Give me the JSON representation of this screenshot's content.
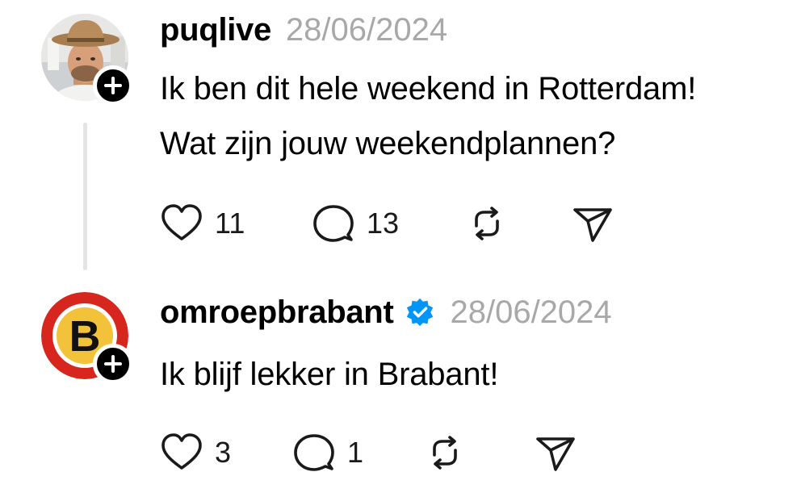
{
  "posts": [
    {
      "username": "puqlive",
      "date": "28/06/2024",
      "verified": false,
      "avatar_icon": "person-photo-avatar",
      "text_lines": [
        "Ik ben dit hele weekend in Rotterdam!",
        "Wat zijn jouw weekendplannen?"
      ],
      "likes": "11",
      "replies": "13"
    },
    {
      "username": "omroepbrabant",
      "date": "28/06/2024",
      "verified": true,
      "avatar_icon": "omroep-brabant-logo",
      "avatar_letter": "B",
      "text_lines": [
        "Ik blijf lekker in Brabant!"
      ],
      "likes": "3",
      "replies": "1"
    }
  ],
  "colors": {
    "date_gray": "#a8a8a8",
    "thread_line": "#e4e4e4",
    "verified_blue": "#0095f6",
    "brand_red": "#d7261e",
    "brand_yellow": "#f2c33a"
  },
  "icons": [
    "heart-icon",
    "comment-icon",
    "repost-icon",
    "share-icon",
    "plus-icon",
    "verified-badge-icon"
  ]
}
